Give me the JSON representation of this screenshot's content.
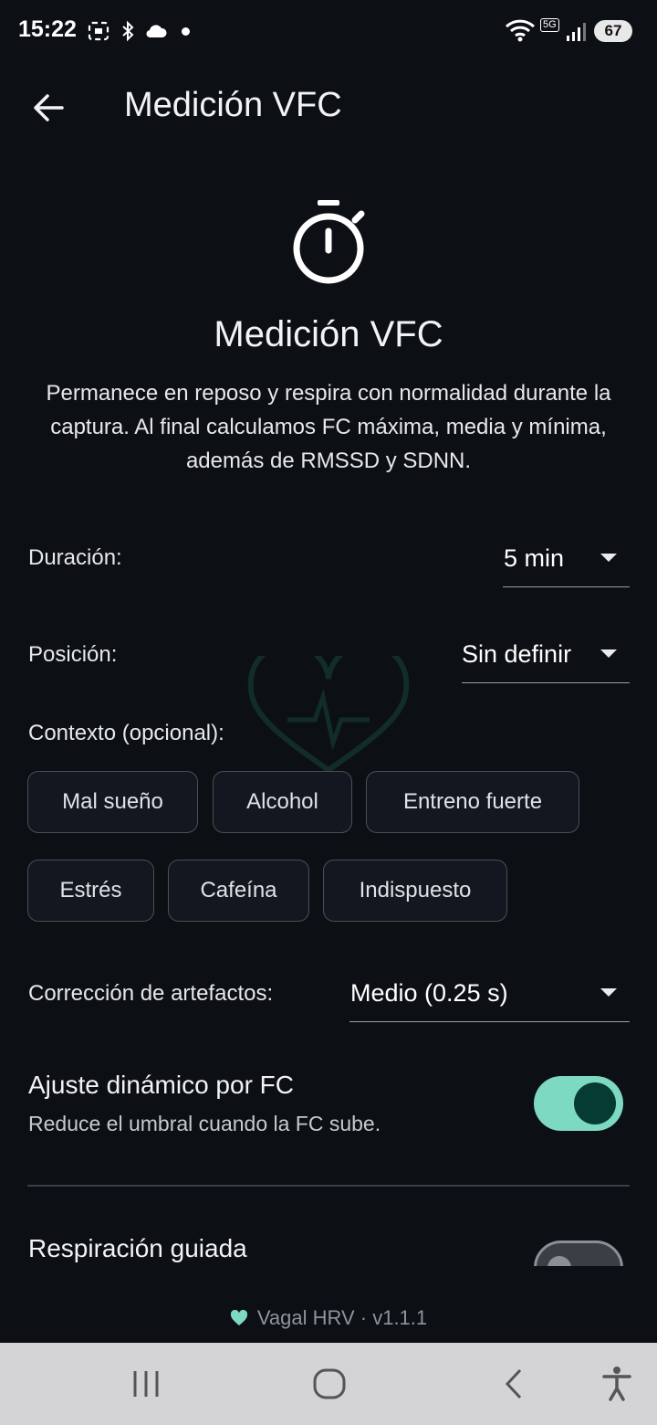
{
  "status_bar": {
    "time": "15:22",
    "network": "5G",
    "battery": "67",
    "icons": [
      "screenshot-icon",
      "bluetooth-icon",
      "cloud-icon",
      "notification-dot-icon",
      "wifi-icon",
      "signal-icon",
      "battery-icon"
    ]
  },
  "app_bar": {
    "title": "Medición VFC",
    "back_icon": "arrow-left-icon"
  },
  "header": {
    "icon": "stopwatch-icon",
    "title": "Medición VFC",
    "description": "Permanece en reposo y respira con normalidad durante la captura. Al final calculamos FC máxima, media y mínima, además de RMSSD y SDNN."
  },
  "form": {
    "duration": {
      "label": "Duración:",
      "value": "5 min"
    },
    "position": {
      "label": "Posición:",
      "value": "Sin definir"
    },
    "context": {
      "label": "Contexto (opcional):",
      "chips": [
        "Mal sueño",
        "Alcohol",
        "Entreno fuerte",
        "Estrés",
        "Cafeína",
        "Indispuesto"
      ]
    },
    "artifact_correction": {
      "label": "Corrección de artefactos:",
      "value": "Medio (0.25 s)"
    },
    "dynamic_adjust": {
      "title": "Ajuste dinámico por FC",
      "subtitle": "Reduce el umbral cuando la FC sube.",
      "enabled": true
    },
    "guided_breathing": {
      "title": "Respiración guiada",
      "enabled": false
    }
  },
  "footer": {
    "text": "Vagal HRV · v1.1.1",
    "icon": "heart-icon"
  },
  "colors": {
    "background": "#0c0f14",
    "accent": "#7dd9c2",
    "accent_dark": "#063b34"
  },
  "nav_bar": {
    "icons": [
      "recent-apps-icon",
      "home-icon",
      "back-icon",
      "accessibility-icon"
    ]
  }
}
